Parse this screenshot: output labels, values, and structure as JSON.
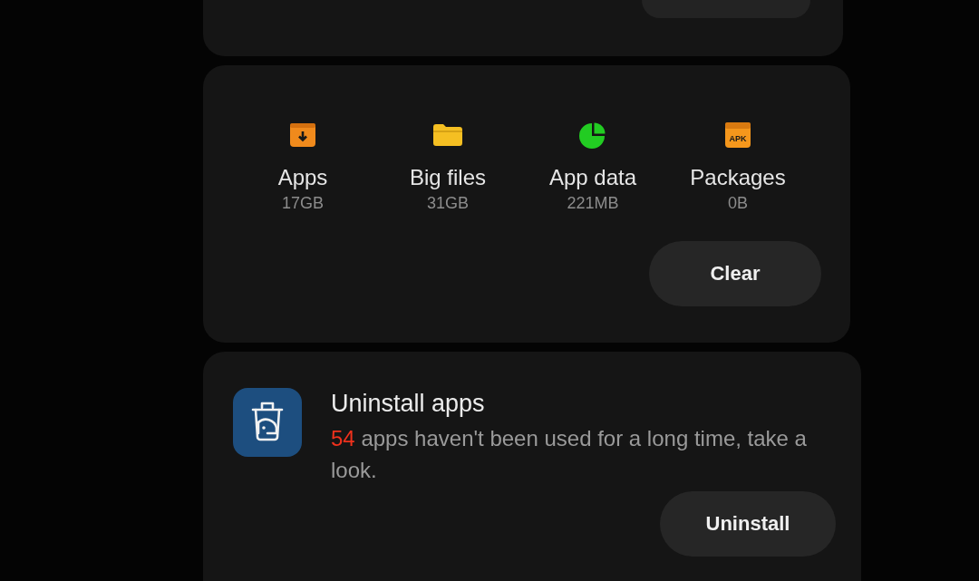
{
  "storage_card": {
    "categories": [
      {
        "kind": "apps",
        "label": "Apps",
        "size": "17GB"
      },
      {
        "kind": "files",
        "label": "Big files",
        "size": "31GB"
      },
      {
        "kind": "data",
        "label": "App data",
        "size": "221MB"
      },
      {
        "kind": "packages",
        "label": "Packages",
        "size": "0B",
        "icon_text": "APK"
      }
    ],
    "button": "Clear"
  },
  "uninstall_card": {
    "title": "Uninstall apps",
    "count": "54",
    "description": "apps haven't been used for a long time, take a look.",
    "button": "Uninstall"
  }
}
